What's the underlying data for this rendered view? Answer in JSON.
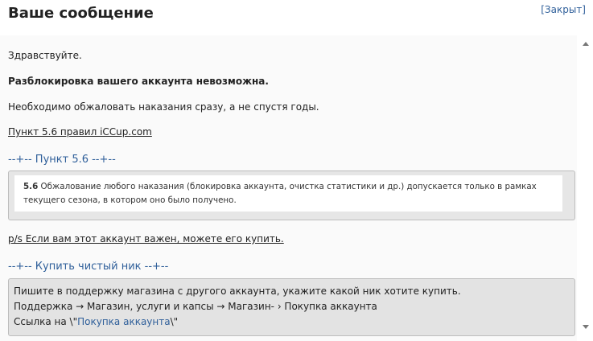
{
  "header": {
    "title": "Ваше сообщение",
    "close_label": "[Закрыт]"
  },
  "message": {
    "greeting": "Здравствуйте.",
    "headline": "Разблокировка вашего аккаунта невозможна.",
    "appeal_note": "Необходимо обжаловать наказания сразу, а не спустя годы.",
    "rules_link": "Пункт 5.6 правил iCCup.com",
    "rule_section_title": "--+-- Пункт 5.6 --+--",
    "rule_number": "5.6",
    "rule_text_line1": " Обжалование любого наказания (блокировка аккаунта, очистка статистики и др.) допускается только в рамках",
    "rule_text_line2": "текущего сезона, в котором оно было получено.",
    "ps_link": "p/s Если вам этот аккаунт важен, можете его купить.",
    "buy_section_title": "--+-- Купить чистый ник --+--",
    "buy_line1": "Пишите в поддержку магазина с другого аккаунта, укажите какой ник хотите купить.",
    "buy_line2": "Поддержка → Магазин, услуги и капсы → Магазин- › Покупка аккаунта",
    "buy_line3_prefix": "Ссылка на \\\"",
    "buy_line3_link": "Покупка аккаунта",
    "buy_line3_suffix": "\\\""
  },
  "colors": {
    "link_blue": "#2f5f9a",
    "box_gray": "#e6e6e6"
  }
}
